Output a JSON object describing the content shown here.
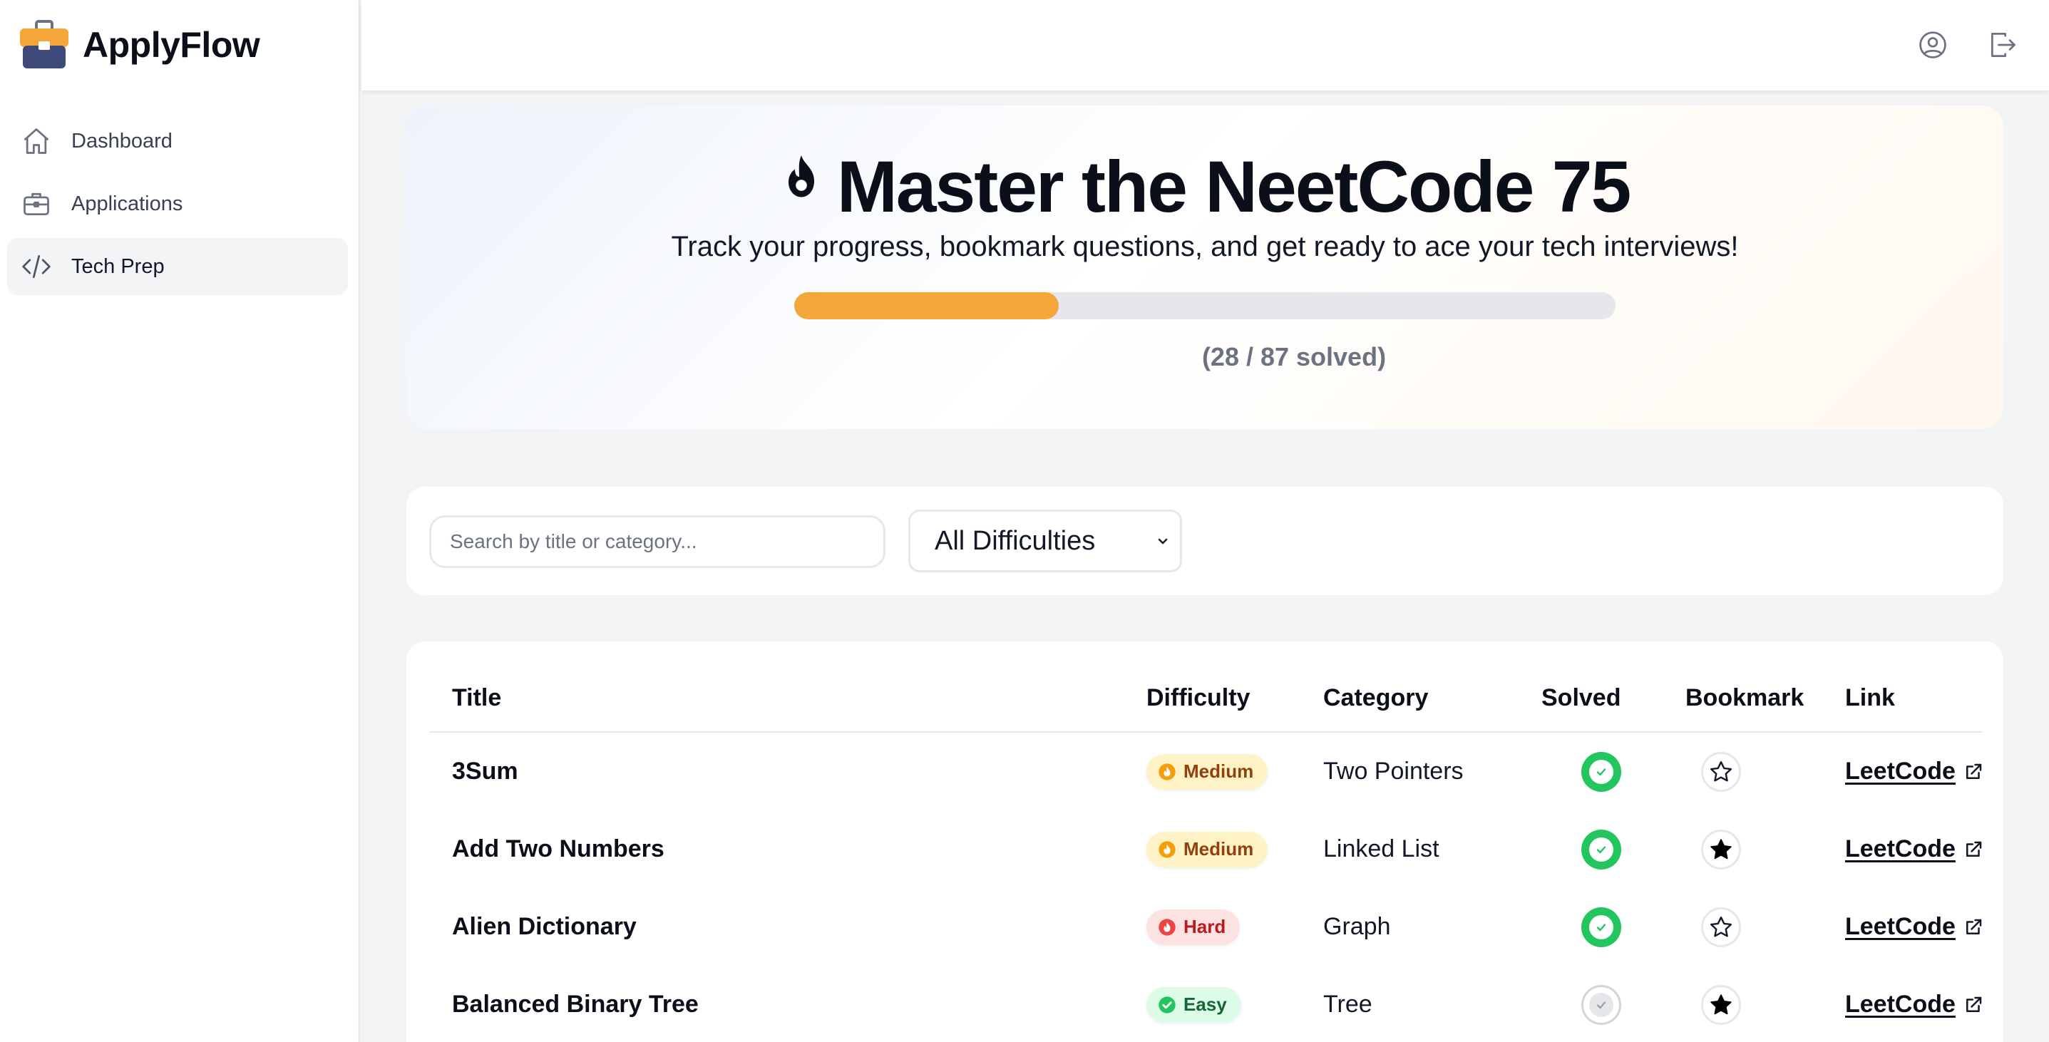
{
  "app": {
    "name": "ApplyFlow"
  },
  "sidebar": {
    "items": [
      {
        "label": "Dashboard",
        "icon": "home-icon",
        "active": false
      },
      {
        "label": "Applications",
        "icon": "briefcase-icon",
        "active": false
      },
      {
        "label": "Tech Prep",
        "icon": "code-icon",
        "active": true
      }
    ]
  },
  "topbar": {
    "icons": [
      "user-circle-icon",
      "logout-icon"
    ]
  },
  "hero": {
    "title": "Master the NeetCode 75",
    "subtitle": "Track your progress, bookmark questions, and get ready to ace your tech interviews!",
    "solved": 28,
    "total": 87,
    "progress_text": "(28 / 87 solved)",
    "progress_fraction": 0.322,
    "progress_color": "#f4a63a"
  },
  "filters": {
    "search_placeholder": "Search by title or category...",
    "difficulty_selected": "All Difficulties"
  },
  "table": {
    "headers": {
      "title": "Title",
      "difficulty": "Difficulty",
      "category": "Category",
      "solved": "Solved",
      "bookmark": "Bookmark",
      "link": "Link"
    },
    "rows": [
      {
        "title": "3Sum",
        "difficulty": "Medium",
        "category": "Two Pointers",
        "solved": true,
        "bookmarked": false,
        "link": "LeetCode"
      },
      {
        "title": "Add Two Numbers",
        "difficulty": "Medium",
        "category": "Linked List",
        "solved": true,
        "bookmarked": true,
        "link": "LeetCode"
      },
      {
        "title": "Alien Dictionary",
        "difficulty": "Hard",
        "category": "Graph",
        "solved": true,
        "bookmarked": false,
        "link": "LeetCode"
      },
      {
        "title": "Balanced Binary Tree",
        "difficulty": "Easy",
        "category": "Tree",
        "solved": false,
        "bookmarked": true,
        "link": "LeetCode"
      }
    ]
  },
  "colors": {
    "accent": "#f4a63a",
    "solved_green": "#22c55e",
    "medium_bg": "#fef3c7",
    "hard_bg": "#fde2e2",
    "easy_bg": "#dcfce7"
  }
}
